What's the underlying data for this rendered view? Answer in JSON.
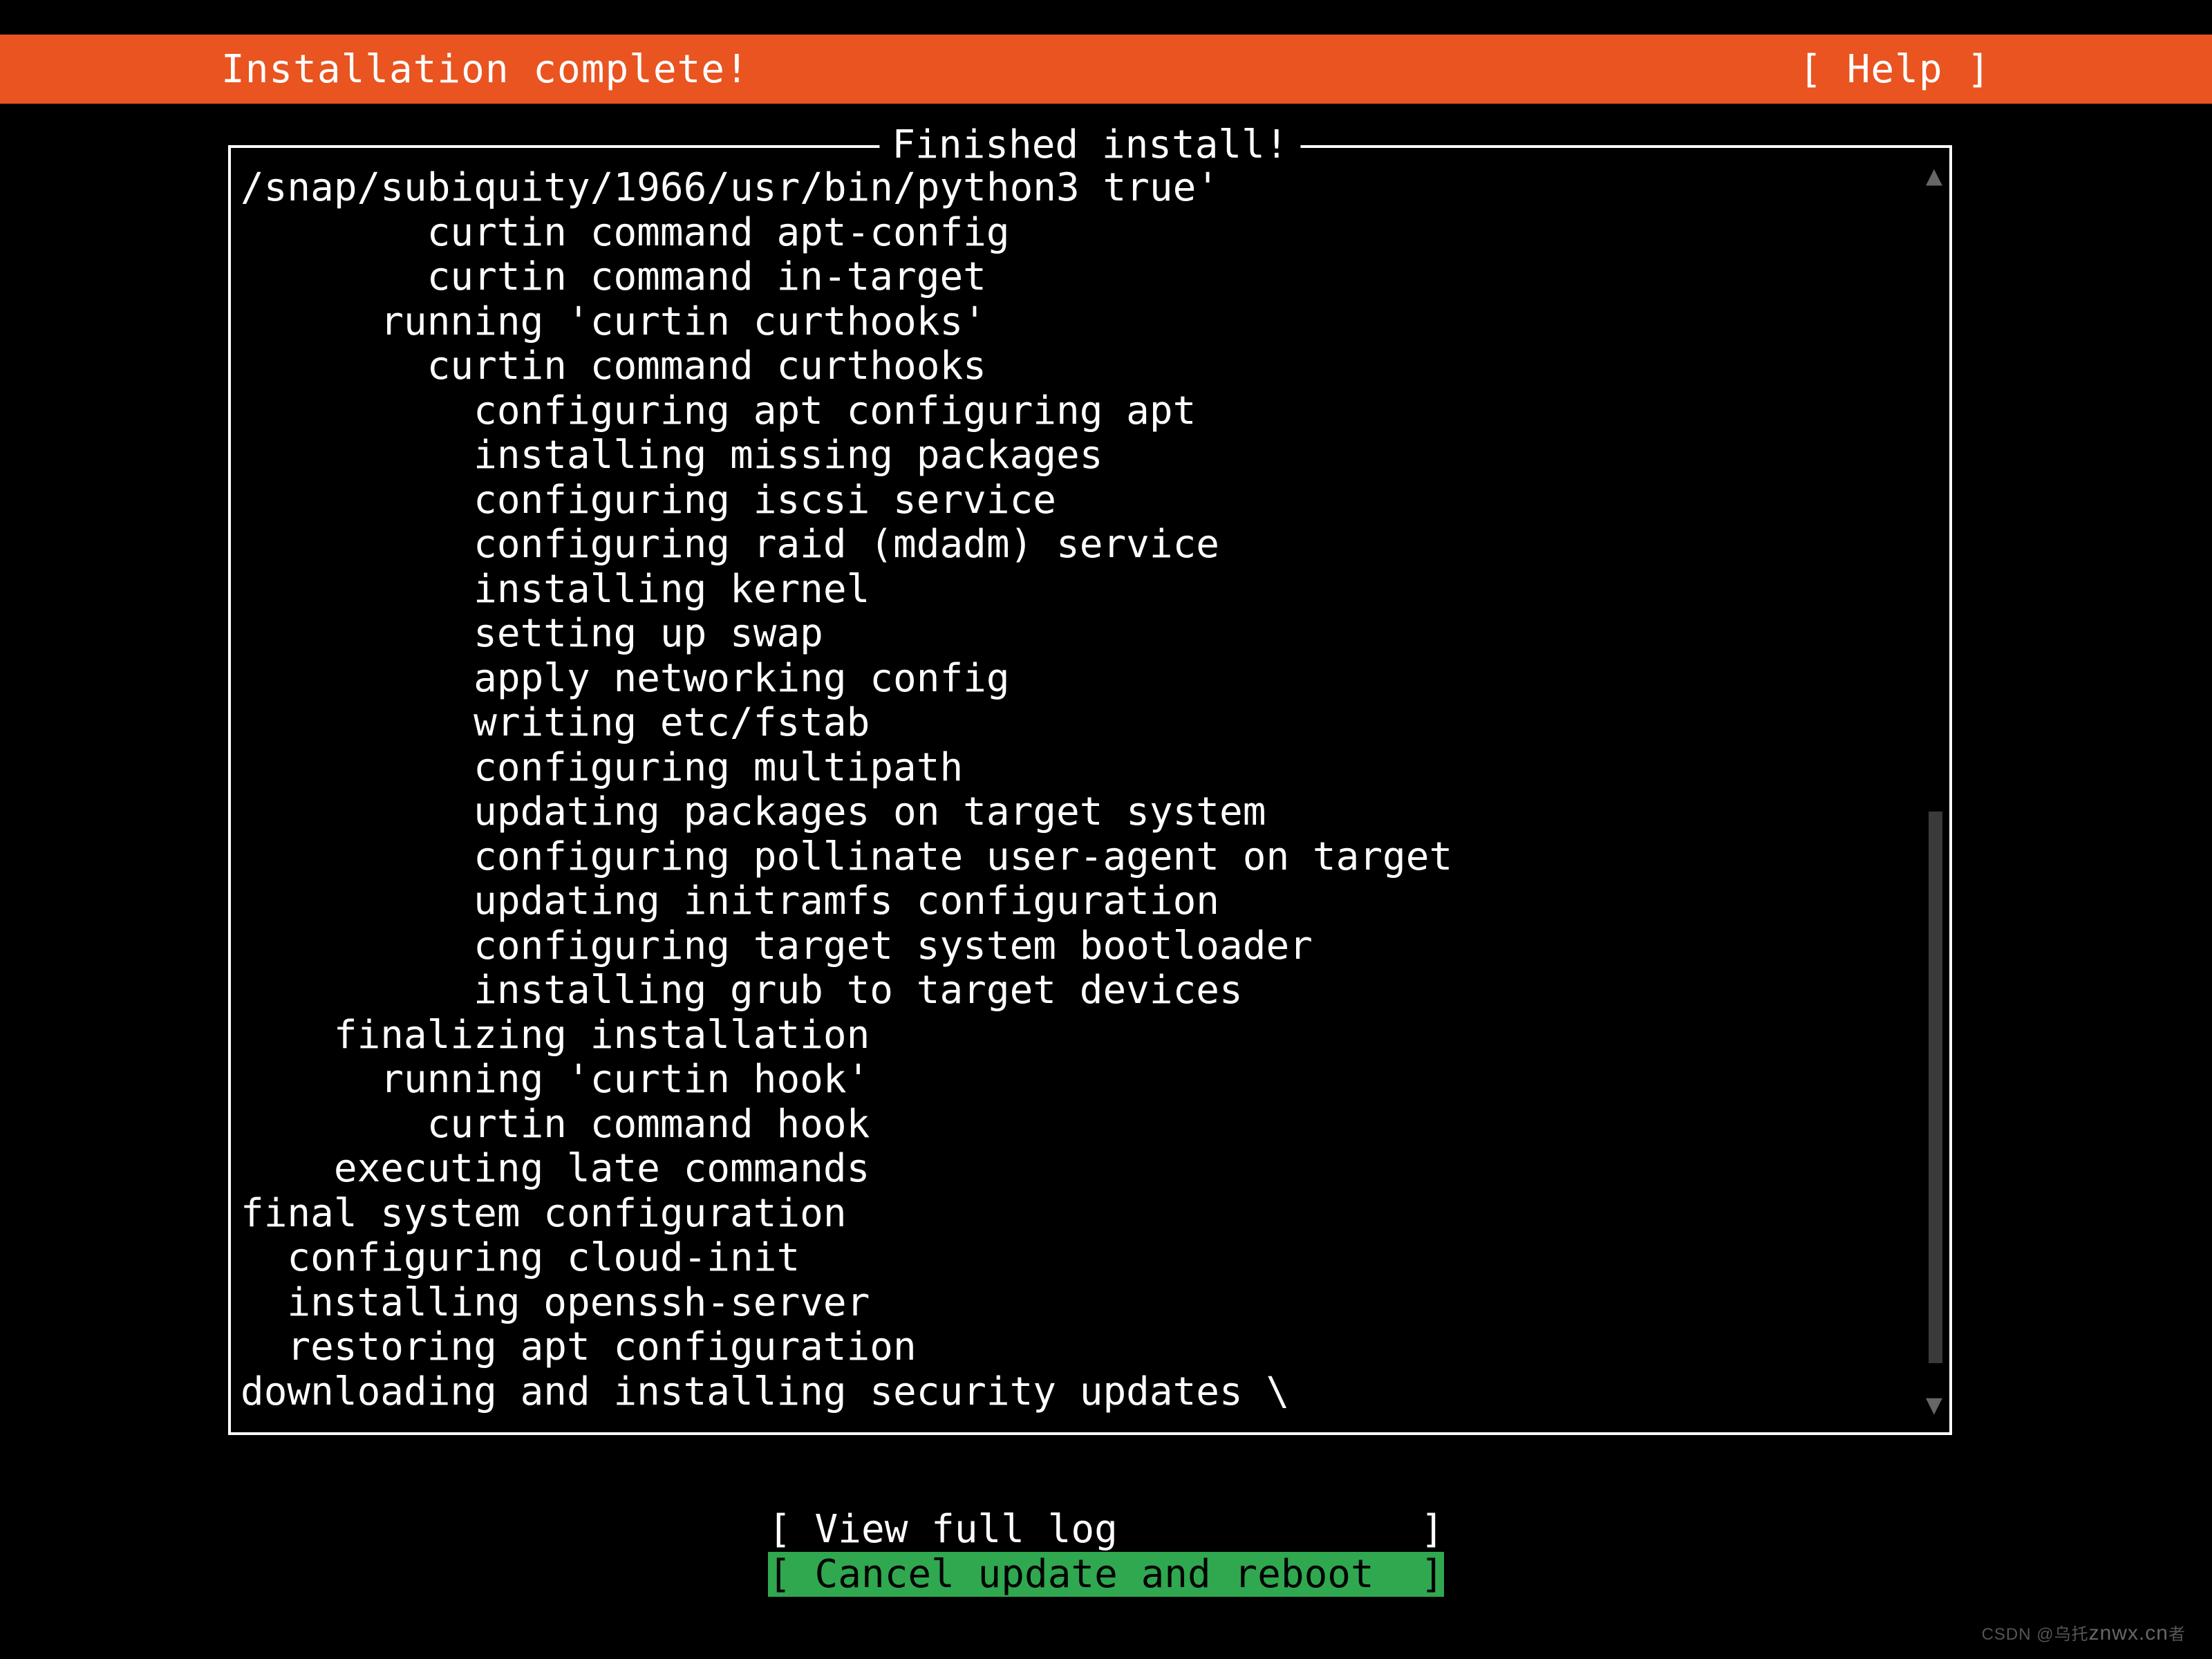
{
  "header": {
    "title": "Installation complete!",
    "help": "[ Help ]"
  },
  "box": {
    "title": " Finished install! "
  },
  "log_lines": [
    {
      "indent": 0,
      "text": "/snap/subiquity/1966/usr/bin/python3 true'"
    },
    {
      "indent": 8,
      "text": "curtin command apt-config"
    },
    {
      "indent": 8,
      "text": "curtin command in-target"
    },
    {
      "indent": 6,
      "text": "running 'curtin curthooks'"
    },
    {
      "indent": 8,
      "text": "curtin command curthooks"
    },
    {
      "indent": 10,
      "text": "configuring apt configuring apt"
    },
    {
      "indent": 10,
      "text": "installing missing packages"
    },
    {
      "indent": 10,
      "text": "configuring iscsi service"
    },
    {
      "indent": 10,
      "text": "configuring raid (mdadm) service"
    },
    {
      "indent": 10,
      "text": "installing kernel"
    },
    {
      "indent": 10,
      "text": "setting up swap"
    },
    {
      "indent": 10,
      "text": "apply networking config"
    },
    {
      "indent": 10,
      "text": "writing etc/fstab"
    },
    {
      "indent": 10,
      "text": "configuring multipath"
    },
    {
      "indent": 10,
      "text": "updating packages on target system"
    },
    {
      "indent": 10,
      "text": "configuring pollinate user-agent on target"
    },
    {
      "indent": 10,
      "text": "updating initramfs configuration"
    },
    {
      "indent": 10,
      "text": "configuring target system bootloader"
    },
    {
      "indent": 10,
      "text": "installing grub to target devices"
    },
    {
      "indent": 4,
      "text": "finalizing installation"
    },
    {
      "indent": 6,
      "text": "running 'curtin hook'"
    },
    {
      "indent": 8,
      "text": "curtin command hook"
    },
    {
      "indent": 4,
      "text": "executing late commands"
    },
    {
      "indent": 0,
      "text": "final system configuration"
    },
    {
      "indent": 2,
      "text": "configuring cloud-init"
    },
    {
      "indent": 2,
      "text": "installing openssh-server"
    },
    {
      "indent": 2,
      "text": "restoring apt configuration"
    },
    {
      "indent": 0,
      "text": "downloading and installing security updates \\"
    }
  ],
  "scroll": {
    "up": "▲",
    "down": "▼"
  },
  "buttons": {
    "view_log": "[ View full log             ]",
    "cancel": "[ Cancel update and reboot  ]"
  },
  "watermark": {
    "left": "CSDN @乌托",
    "right": "znwx.cn",
    "tail": "者"
  }
}
